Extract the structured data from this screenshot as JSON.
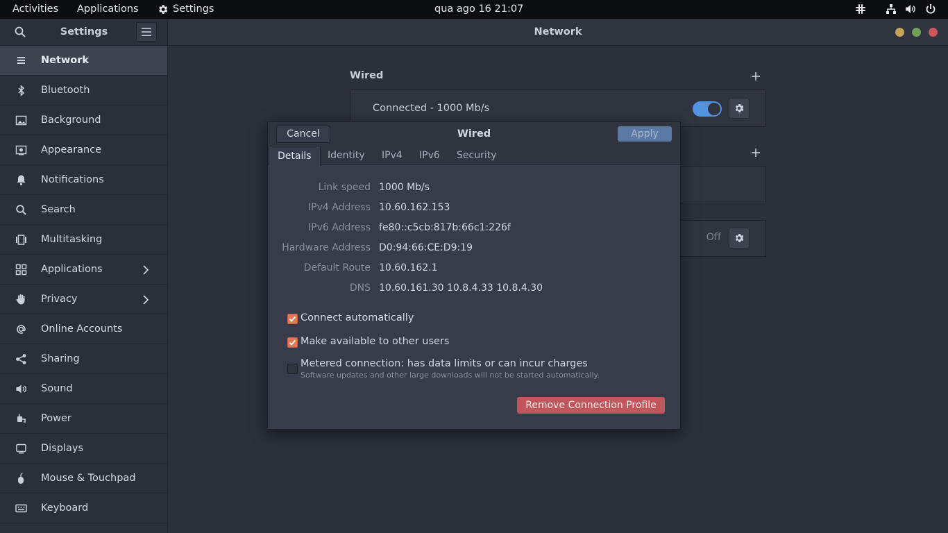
{
  "topbar": {
    "activities": "Activities",
    "applications": "Applications",
    "app_name": "Settings",
    "clock": "qua ago 16  21:07",
    "tray_icons": [
      "slack-icon",
      "network-icon",
      "volume-icon",
      "power-icon"
    ]
  },
  "headerbar": {
    "sidebar_title": "Settings",
    "page_title": "Network",
    "window_buttons": {
      "minimize": "#c5a35b",
      "maximize": "#6f9f59",
      "close": "#c9575d"
    }
  },
  "sidebar": {
    "items": [
      {
        "label": "Network",
        "icon": "network-icon",
        "active": true
      },
      {
        "label": "Bluetooth",
        "icon": "bluetooth-icon"
      },
      {
        "label": "Background",
        "icon": "background-icon"
      },
      {
        "label": "Appearance",
        "icon": "appearance-icon"
      },
      {
        "label": "Notifications",
        "icon": "bell-icon"
      },
      {
        "label": "Search",
        "icon": "search-icon"
      },
      {
        "label": "Multitasking",
        "icon": "multitasking-icon"
      },
      {
        "label": "Applications",
        "icon": "grid-icon",
        "chevron": true
      },
      {
        "label": "Privacy",
        "icon": "hand-icon",
        "chevron": true
      },
      {
        "label": "Online Accounts",
        "icon": "at-icon"
      },
      {
        "label": "Sharing",
        "icon": "share-icon"
      },
      {
        "label": "Sound",
        "icon": "speaker-icon"
      },
      {
        "label": "Power",
        "icon": "power-plug-icon"
      },
      {
        "label": "Displays",
        "icon": "display-icon"
      },
      {
        "label": "Mouse & Touchpad",
        "icon": "mouse-icon"
      },
      {
        "label": "Keyboard",
        "icon": "keyboard-icon"
      }
    ]
  },
  "network": {
    "wired_title": "Wired",
    "wired_status": "Connected - 1000 Mb/s",
    "wired_enabled": true,
    "vpn_status": "Off"
  },
  "dialog": {
    "title": "Wired",
    "cancel": "Cancel",
    "apply": "Apply",
    "tabs": [
      "Details",
      "Identity",
      "IPv4",
      "IPv6",
      "Security"
    ],
    "active_tab": "Details",
    "details": [
      {
        "label": "Link speed",
        "value": "1000 Mb/s"
      },
      {
        "label": "IPv4 Address",
        "value": "10.60.162.153"
      },
      {
        "label": "IPv6 Address",
        "value": "fe80::c5cb:817b:66c1:226f"
      },
      {
        "label": "Hardware Address",
        "value": "D0:94:66:CE:D9:19"
      },
      {
        "label": "Default Route",
        "value": "10.60.162.1"
      },
      {
        "label": "DNS",
        "value": "10.60.161.30 10.8.4.33 10.8.4.30"
      }
    ],
    "connect_automatically": {
      "label": "Connect automatically",
      "checked": true
    },
    "make_available": {
      "label": "Make available to other users",
      "checked": true
    },
    "metered": {
      "label": "Metered connection: has data limits or can incur charges",
      "sublabel": "Software updates and other large downloads will not be started automatically.",
      "checked": false
    },
    "remove_button": "Remove Connection Profile"
  },
  "colors": {
    "accent": "#5294e2",
    "checkbox": "#e0795a",
    "destructive": "#c0575d"
  }
}
